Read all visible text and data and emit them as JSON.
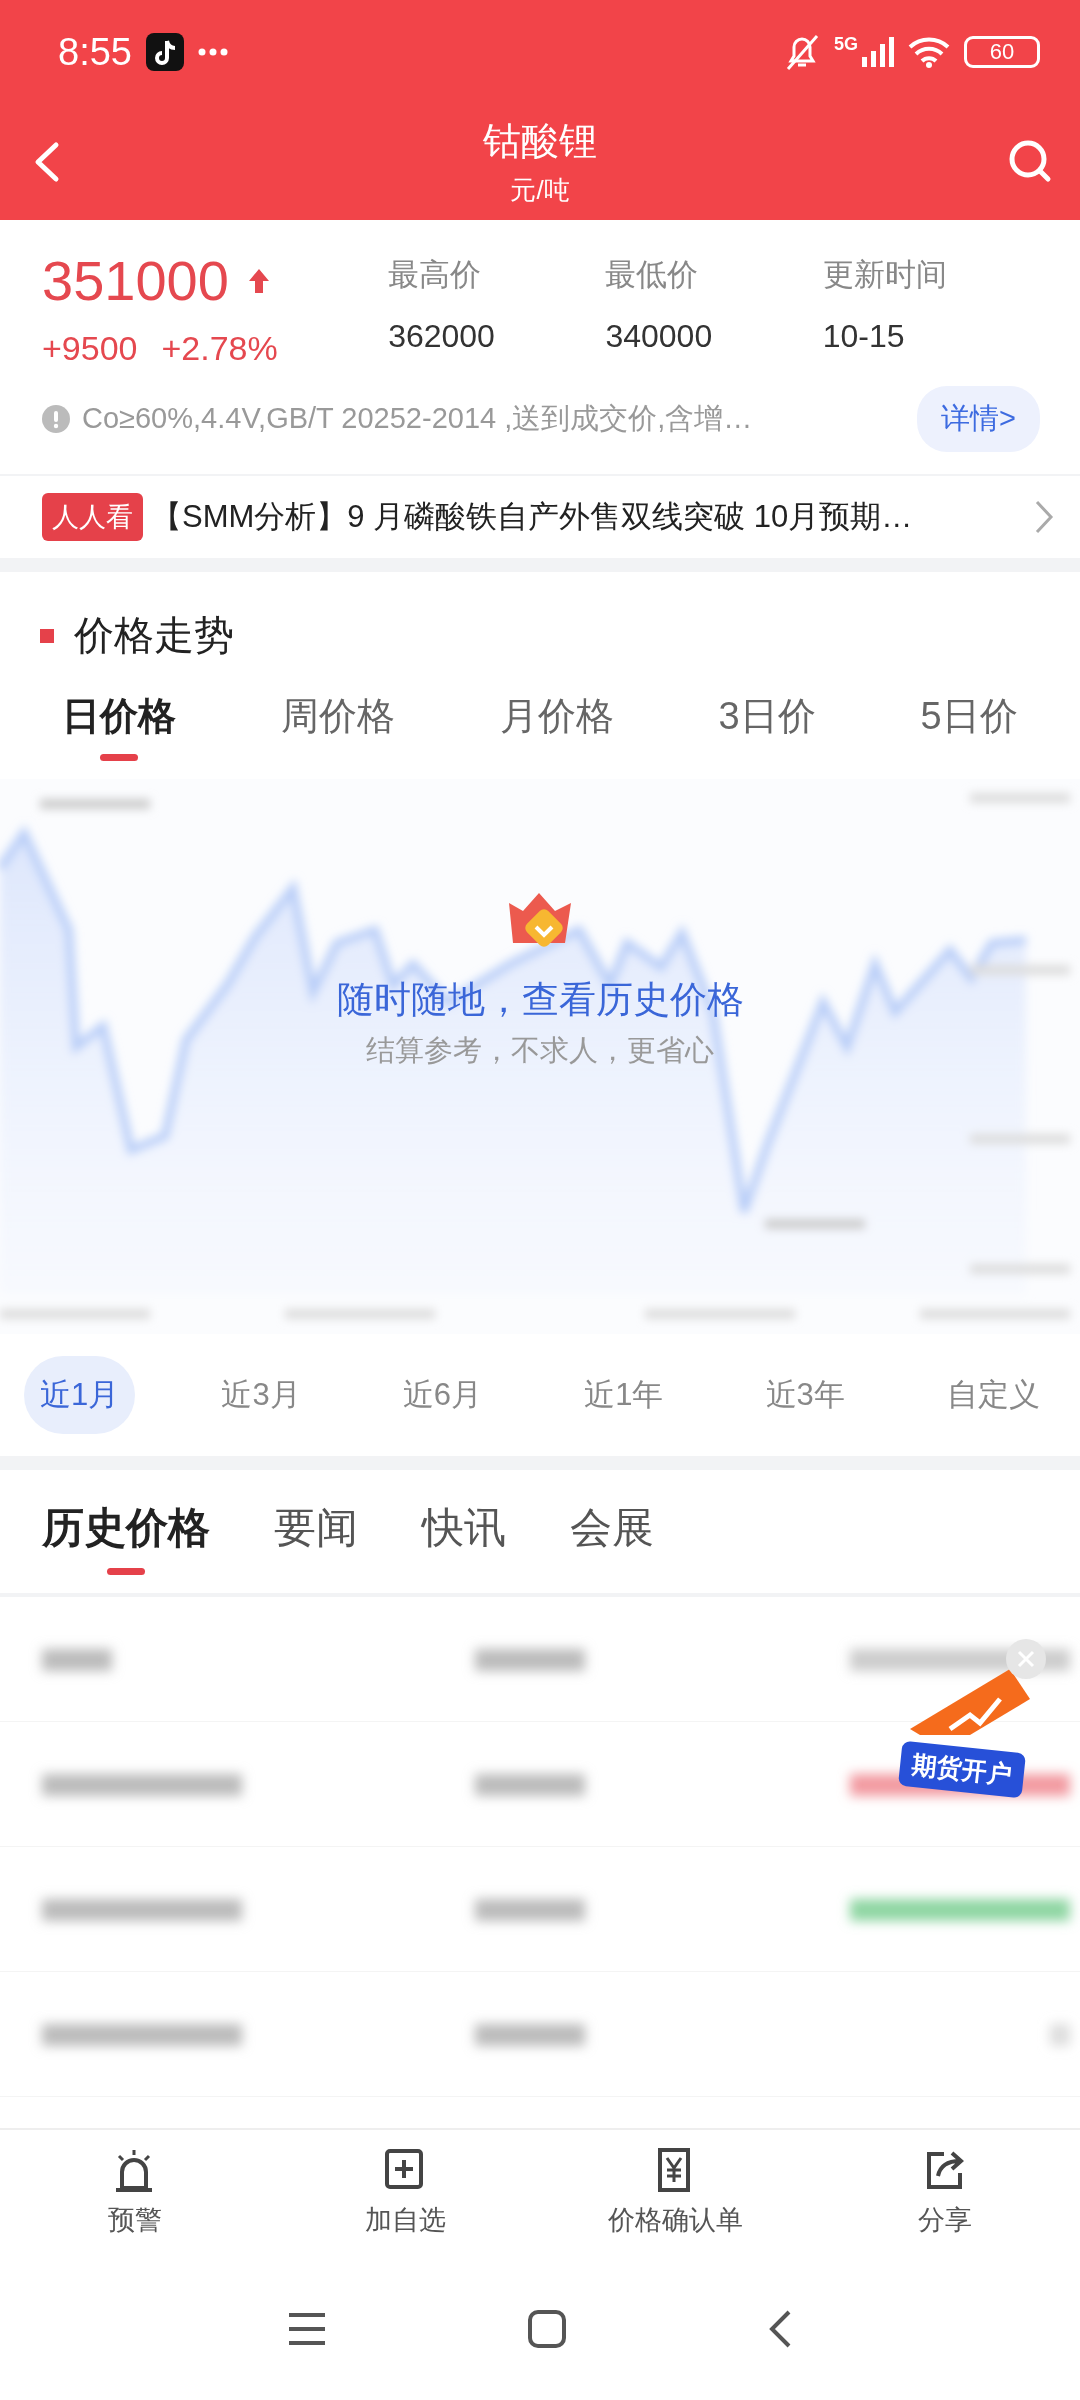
{
  "status_bar": {
    "time": "8:55",
    "network": "5G",
    "battery": "60"
  },
  "header": {
    "title": "钴酸锂",
    "subtitle": "元/吨"
  },
  "quote": {
    "price": "351000",
    "change": "+9500",
    "change_pct": "+2.78%",
    "stats": [
      {
        "label": "最高价",
        "value": "362000"
      },
      {
        "label": "最低价",
        "value": "340000"
      },
      {
        "label": "更新时间",
        "value": "10-15"
      }
    ],
    "note": "Co≥60%,4.4V,GB/T 20252-2014 ,送到成交价,含增…",
    "details_button": "详情>"
  },
  "news": {
    "tag": "人人看",
    "headline": "【SMM分析】9 月磷酸铁自产外售双线突破 10月预期…"
  },
  "trend": {
    "title": "价格走势",
    "tabs": [
      {
        "label": "日价格",
        "selected": true
      },
      {
        "label": "周价格",
        "selected": false
      },
      {
        "label": "月价格",
        "selected": false
      },
      {
        "label": "3日价",
        "selected": false
      },
      {
        "label": "5日价",
        "selected": false
      }
    ],
    "overlay": {
      "title": "随时随地，查看历史价格",
      "subtitle": "结算参考，不求人，更省心"
    },
    "ranges": [
      {
        "label": "近1月",
        "selected": true
      },
      {
        "label": "近3月",
        "selected": false
      },
      {
        "label": "近6月",
        "selected": false
      },
      {
        "label": "近1年",
        "selected": false
      },
      {
        "label": "近3年",
        "selected": false
      },
      {
        "label": "自定义",
        "selected": false
      }
    ]
  },
  "section_tabs": [
    {
      "label": "历史价格",
      "selected": true
    },
    {
      "label": "要闻",
      "selected": false
    },
    {
      "label": "快讯",
      "selected": false
    },
    {
      "label": "会展",
      "selected": false
    }
  ],
  "blurred_rows": [
    {
      "kind": "header"
    },
    {
      "kind": "up"
    },
    {
      "kind": "down"
    },
    {
      "kind": "flat"
    }
  ],
  "promo": {
    "label": "期货开户"
  },
  "bottom_nav": [
    {
      "kind": "alarm",
      "label": "预警"
    },
    {
      "kind": "add",
      "label": "加自选"
    },
    {
      "kind": "receipt",
      "label": "价格确认单"
    },
    {
      "kind": "share",
      "label": "分享"
    }
  ]
}
